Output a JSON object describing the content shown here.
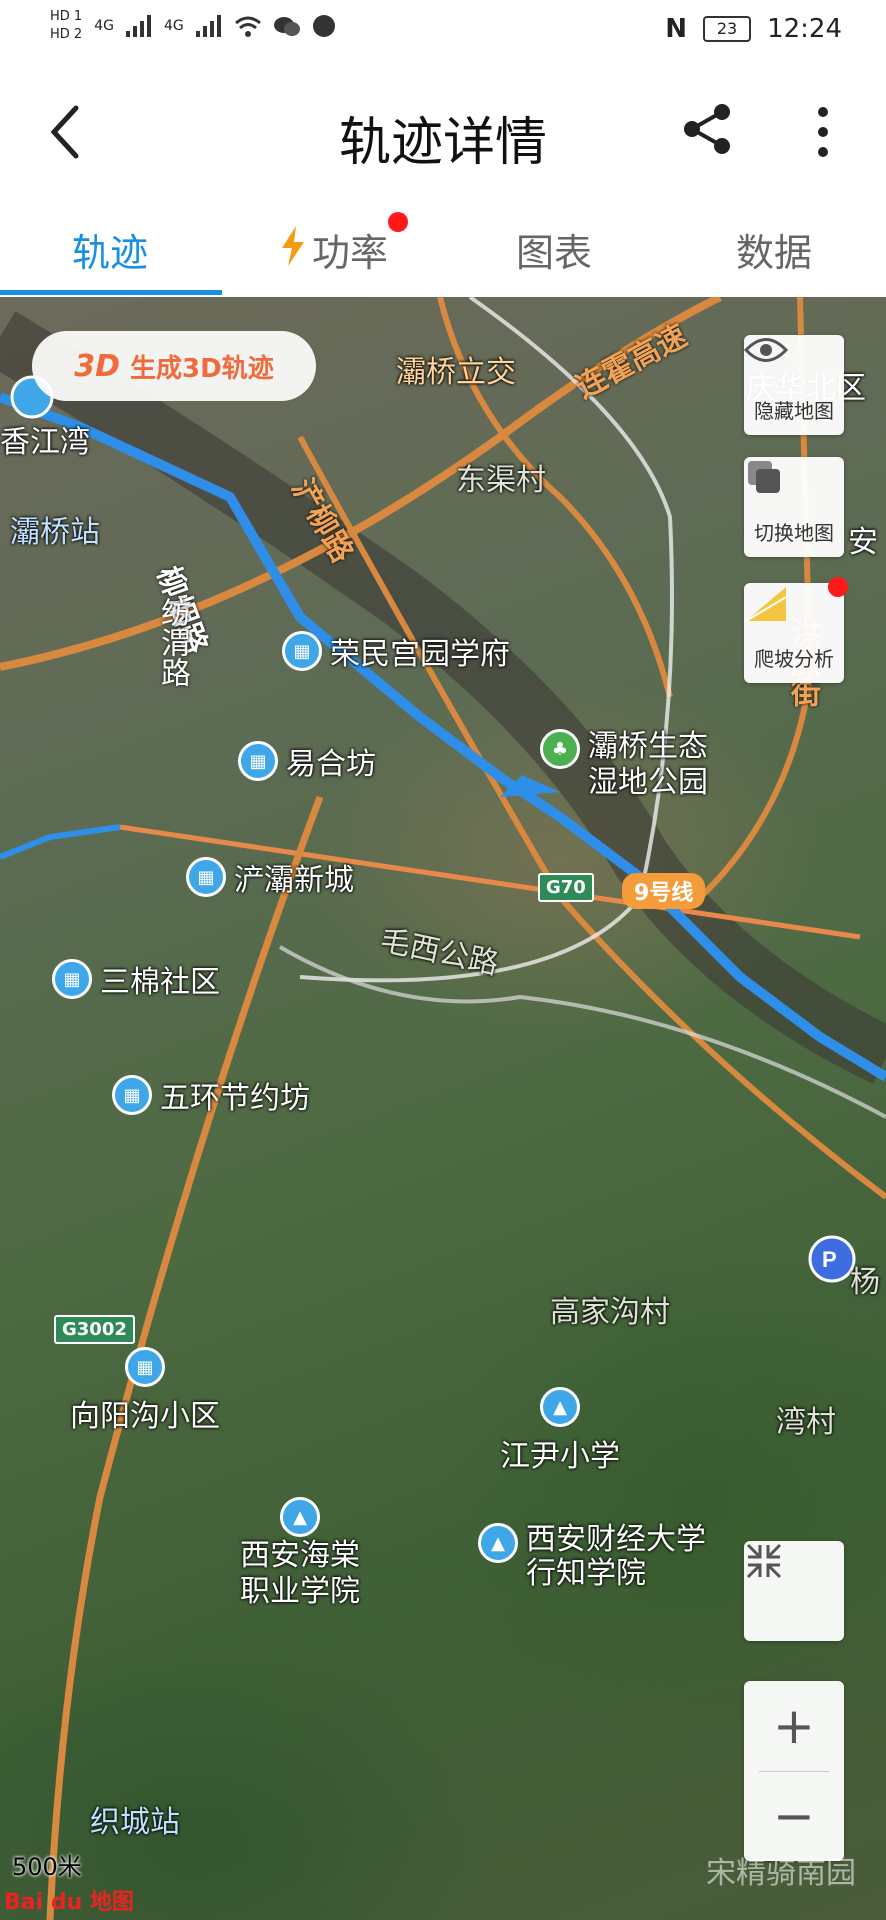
{
  "status_bar": {
    "hd1": "HD 1",
    "hd2": "HD 2",
    "signal1": "4G",
    "signal2": "4G",
    "nfc": "N",
    "battery": "23",
    "time": "12:24"
  },
  "header": {
    "title": "轨迹详情"
  },
  "tabs": [
    {
      "label": "轨迹",
      "active": true
    },
    {
      "label": "功率",
      "active": false,
      "has_dot": true
    },
    {
      "label": "图表",
      "active": false
    },
    {
      "label": "数据",
      "active": false
    }
  ],
  "map": {
    "btn3d": {
      "prefix": "3D",
      "label": "生成3D轨迹"
    },
    "side_buttons": [
      {
        "label": "隐藏地图",
        "icon": "eye-icon"
      },
      {
        "label": "切换地图",
        "icon": "layers-icon"
      },
      {
        "label": "爬坡分析",
        "icon": "slope-icon",
        "has_dot": true
      }
    ],
    "labels": {
      "bachao_lijiao": "灞桥立交",
      "dongqu": "东渠村",
      "xiangjiang": "香江湾",
      "bachao_station": "灞桥站",
      "gaojiagou": "高家沟村",
      "maoxi": "毛西公路",
      "yang": "杨",
      "qinghuabei": "庆华北区",
      "anyuan": "安",
      "zhicheng": "织城站",
      "lucun": "湾村"
    },
    "roads": {
      "lianhuo": "连霍高速",
      "jiliu": "浐柳路",
      "liuyin": "柳烟路",
      "fangwei": "纺渭路",
      "hongqing": "洪庆街"
    },
    "pois": {
      "rongmin": "荣民宫园学府",
      "yihe": "易合坊",
      "chanba": "浐灞新城",
      "sanmian": "三棉社区",
      "wuhuan": "五环节约坊",
      "xiangyang": "向阳沟小区",
      "xihai": "西安海棠职业学院",
      "xihai_l1": "西安海棠",
      "xihai_l2": "职业学院",
      "jiangyin": "江尹小学",
      "caijing_l1": "西安财经大学",
      "caijing_l2": "行知学院",
      "park_l1": "灞桥生态",
      "park_l2": "湿地公园"
    },
    "badges": {
      "g70": "G70",
      "line9": "9号线",
      "g3002": "G3002"
    },
    "scale": "500米",
    "logo": "Bai du 地图",
    "watermark": "宋精骑南园"
  }
}
